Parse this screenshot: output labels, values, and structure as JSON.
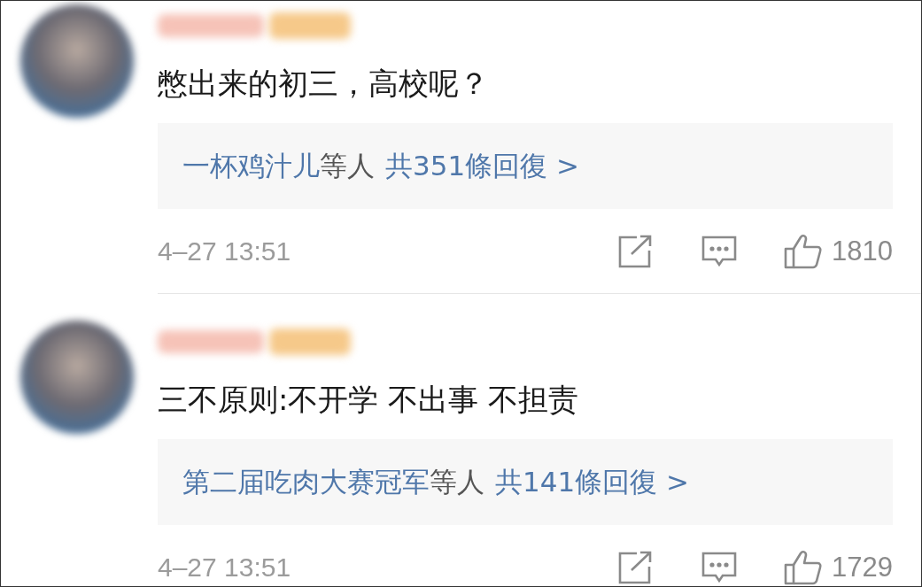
{
  "comments": [
    {
      "text": "憋出来的初三，高校呢？",
      "reply": {
        "users": "一杯鸡汁儿",
        "connector": "等人",
        "summary": "共351條回復 >"
      },
      "time": "4–27 13:51",
      "likes": "1810"
    },
    {
      "text": "三不原则:不开学 不出事 不担责",
      "reply": {
        "users": "第二届吃肉大赛冠军",
        "connector": "等人",
        "summary": "共141條回復 >"
      },
      "time": "4–27 13:51",
      "likes": "1729"
    }
  ]
}
